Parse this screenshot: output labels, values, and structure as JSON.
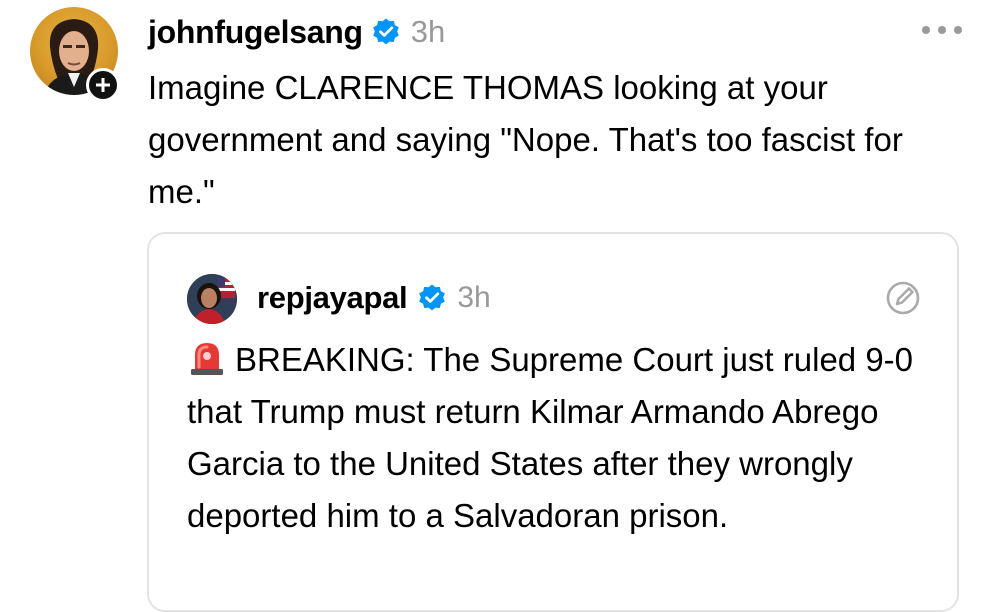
{
  "post": {
    "username": "johnfugelsang",
    "timestamp": "3h",
    "text": "Imagine CLARENCE THOMAS looking at your government and saying \"Nope.  That's too fascist for me.\"",
    "icons": {
      "verified": "verified-badge-icon",
      "follow": "plus-icon",
      "more": "more-options-icon"
    }
  },
  "quoted_post": {
    "username": "repjayapal",
    "timestamp": "3h",
    "text": "BREAKING: The Supreme Court just ruled 9-0 that Trump must return Kilmar Armando Abrego Garcia to the United States after they wrongly deported him to a Salvadoran prison.",
    "icons": {
      "lead": "police-siren-icon",
      "verified": "verified-badge-icon",
      "edited": "edit-icon"
    }
  },
  "colors": {
    "verified_blue": "#0095F6",
    "timestamp_gray": "#999999",
    "card_border": "#E3E3E3",
    "siren_red": "#E53935"
  }
}
